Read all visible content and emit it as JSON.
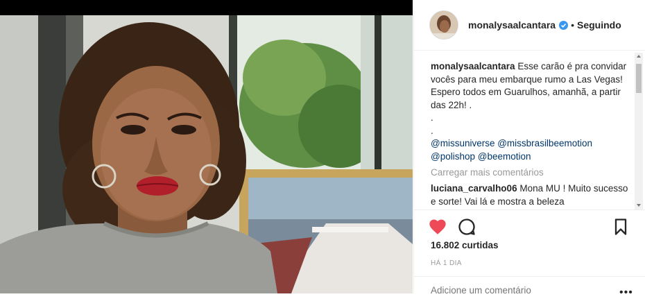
{
  "post": {
    "username": "monalysaalcantara",
    "dot": "•",
    "follow_status": "Seguindo",
    "caption_user": "monalysaalcantara",
    "caption_text": "Esse carão é pra convidar vocês para meu embarque rumo a Las Vegas! Espero todos em Guarulhos, amanhã, a partir das 22h! .",
    "caption_dot1": ".",
    "caption_dot2": ".",
    "tags_line1": "@missuniverse @missbrasilbeemotion",
    "tags_line2": "@polishop @beemotion",
    "load_more": "Carregar mais comentários",
    "comment_user": "luciana_carvalho06",
    "comment_text": "Mona MU ! Muito sucesso e sorte! Vai lá e mostra a beleza",
    "likes": "16.802 curtidas",
    "time": "HÁ 1 DIA",
    "add_comment_placeholder": "Adicione um comentário",
    "more_options": "•••"
  },
  "icons": {
    "like": "heart-filled-icon",
    "comment": "comment-bubble-icon",
    "save": "bookmark-icon",
    "verified": "verified-badge-icon"
  },
  "colors": {
    "like": "#ed4956",
    "verified": "#3897f0",
    "tag": "#003569",
    "muted": "#999999",
    "text": "#262626"
  }
}
